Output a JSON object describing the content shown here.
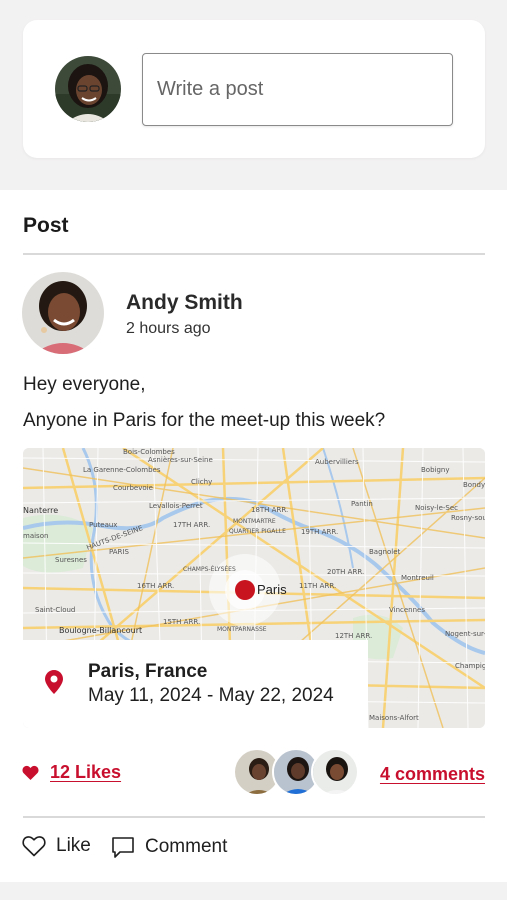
{
  "composer": {
    "placeholder": "Write a post"
  },
  "post": {
    "section_title": "Post",
    "author_name": "Andy Smith",
    "time_ago": "2 hours ago",
    "greeting": "Hey everyone,",
    "message": "Anyone in Paris for the meet-up this week?",
    "map": {
      "pin_label": "Paris",
      "labels": [
        "Bois-Colombes",
        "Asnières-sur-Seine",
        "La Garenne-Colombes",
        "Aubervilliers",
        "Bobigny",
        "Courbevoie",
        "Clichy",
        "Bondy",
        "Nanterre",
        "Levallois-Perret",
        "18TH ARR.",
        "Pantin",
        "Noisy-le-Sec",
        "Puteaux",
        "17TH ARR.",
        "MONTMARTRE",
        "19TH ARR.",
        "HAUTS-DE-SEINE",
        "QUARTIER PIGALLE",
        "Rosny-sous",
        "Suresnes",
        "PARIS",
        "Bagnolet",
        "CHAMPS-ÉLYSÉES",
        "20TH ARR.",
        "16TH ARR.",
        "11TH ARR.",
        "Montreuil",
        "Saint-Cloud",
        "15TH ARR.",
        "Vincennes",
        "Boulogne-Billancourt",
        "MONTPARNASSE",
        "12TH ARR.",
        "Nogent-sur-",
        "Champig",
        "Maisons-Alfort",
        "maison"
      ]
    },
    "location": {
      "name": "Paris, France",
      "dates": "May 11, 2024 - May 22, 2024"
    },
    "likes_label": "12 Likes",
    "comments_label": "4 comments",
    "actions": {
      "like": "Like",
      "comment": "Comment"
    }
  },
  "colors": {
    "accent": "#c8102e",
    "background": "#f3f2f2",
    "card": "#ffffff"
  }
}
